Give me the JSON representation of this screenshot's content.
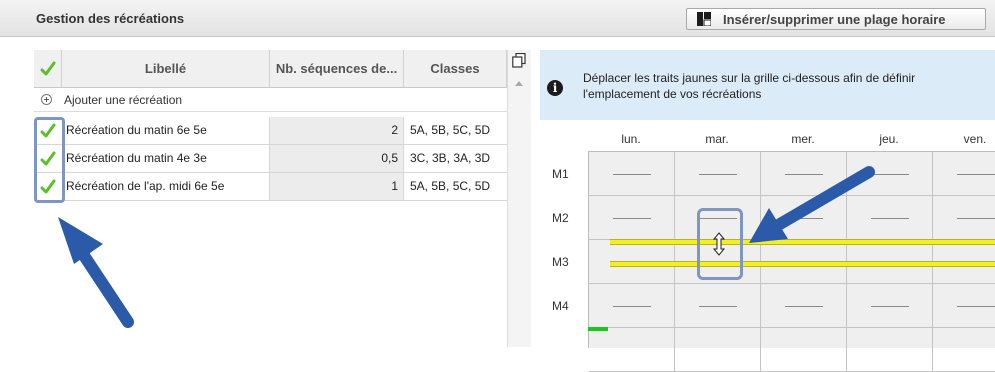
{
  "header": {
    "title": "Gestion des récréations",
    "insert_button_label": "Insérer/supprimer une plage horaire"
  },
  "table": {
    "columns": [
      "Libellé",
      "Nb. séquences de...",
      "Classes"
    ],
    "add_label": "Ajouter une récréation",
    "rows": [
      {
        "checked": true,
        "label": "Récréation du matin 6e 5e",
        "nb": "2",
        "classes": "5A, 5B, 5C, 5D"
      },
      {
        "checked": true,
        "label": "Récréation du matin 4e 3e",
        "nb": "0,5",
        "classes": "3C, 3B, 3A, 3D"
      },
      {
        "checked": true,
        "label": "Récréation de l'ap. midi 6e 5e",
        "nb": "1",
        "classes": "5A, 5B, 5C, 5D"
      }
    ]
  },
  "info": {
    "text": "Déplacer les traits jaunes sur la grille ci-dessous afin de définir l'emplacement de vos récréations"
  },
  "grid": {
    "days": [
      "lun.",
      "mar.",
      "mer.",
      "jeu.",
      "ven."
    ],
    "periods": [
      "M1",
      "M2",
      "M3",
      "M4"
    ]
  },
  "colors": {
    "check": "#5cbf2a",
    "highlight": "#7f95c2",
    "arrow": "#2b5aa8",
    "yellow_line": "#f2f025",
    "info_bg": "#dcebf8"
  },
  "icons": {
    "add": "plus-circle-icon",
    "copy": "copy-icon",
    "info": "info-icon",
    "resize": "vertical-resize-icon",
    "check": "check-icon"
  }
}
